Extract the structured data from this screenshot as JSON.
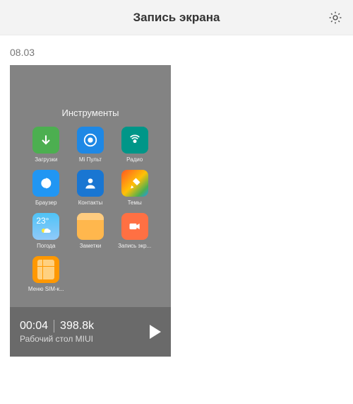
{
  "header": {
    "title": "Запись экрана"
  },
  "date": "08.03",
  "recording": {
    "folder_title": "Инструменты",
    "duration": "00:04",
    "size": "398.8k",
    "subtitle": "Рабочий стол MIUI",
    "apps": [
      {
        "label": "Загрузки"
      },
      {
        "label": "Mi Пульт"
      },
      {
        "label": "Радио"
      },
      {
        "label": "Браузер"
      },
      {
        "label": "Контакты"
      },
      {
        "label": "Темы"
      },
      {
        "label": "Погода",
        "temp": "23°"
      },
      {
        "label": "Заметки"
      },
      {
        "label": "Запись экр..."
      },
      {
        "label": "Меню SIM-к..."
      }
    ]
  }
}
